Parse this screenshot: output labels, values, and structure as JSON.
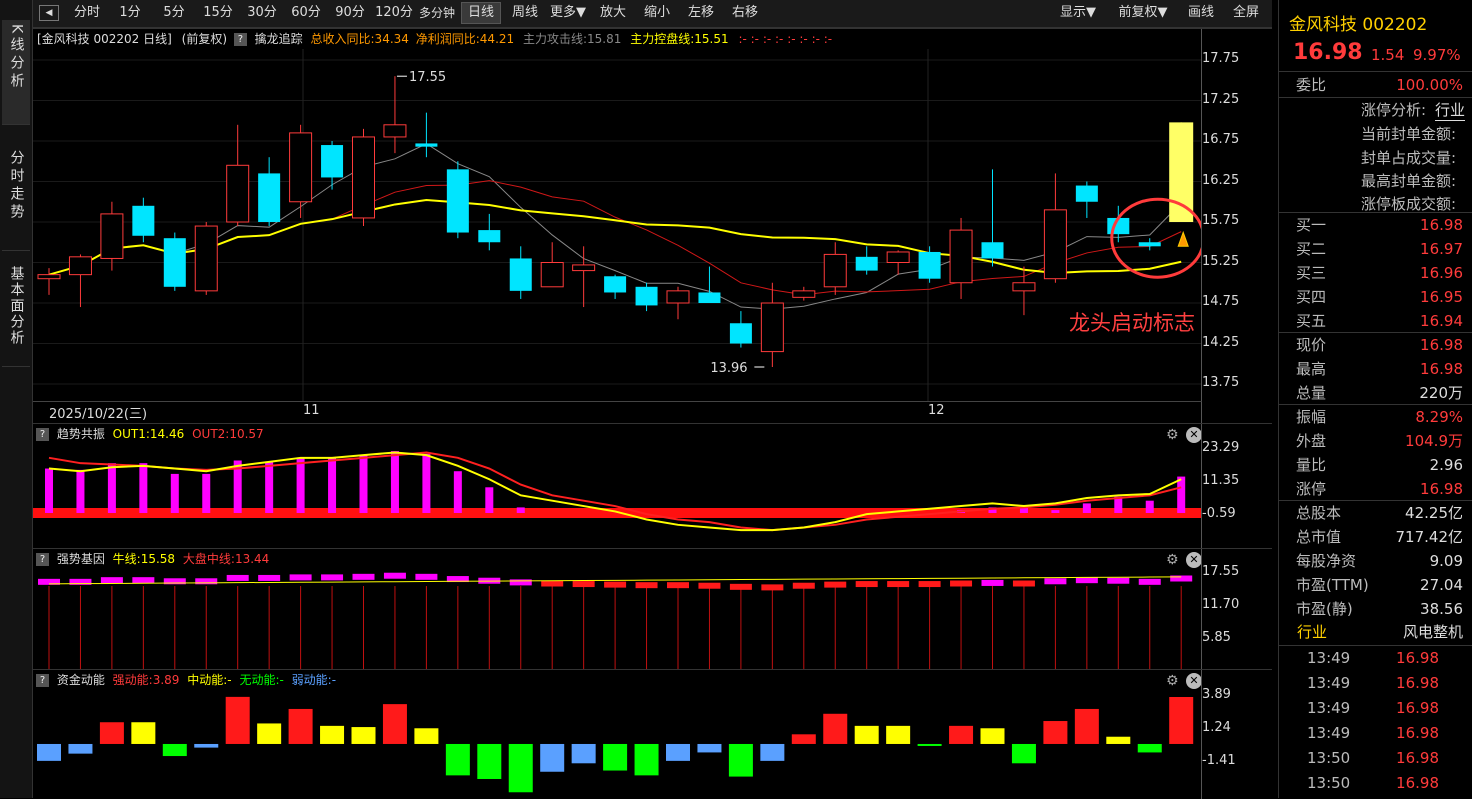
{
  "left_tabs": [
    "K线分析",
    "分时走势",
    "基本面分析"
  ],
  "toolbar": {
    "periods": [
      "分时",
      "1分",
      "5分",
      "15分",
      "30分",
      "60分",
      "90分",
      "120分",
      "多分钟",
      "日线",
      "周线",
      "更多▼",
      "放大",
      "缩小",
      "左移",
      "右移"
    ],
    "active": "日线",
    "right": [
      "显示▼",
      "前复权▼",
      "画线",
      "全屏"
    ]
  },
  "main": {
    "title": "[金风科技 002202 日线]",
    "fq": "(前复权)",
    "indicator": "擒龙追踪",
    "rev": "总收入同比:34.34",
    "profit": "净利润同比:44.21",
    "attack": "主力攻击线:15.81",
    "control": "主力控盘线:15.51",
    "dots": ":- :- :- :- :- :- :- :-",
    "y_ticks": [
      "17.75",
      "17.25",
      "16.75",
      "16.25",
      "15.75",
      "15.25",
      "14.75",
      "14.25",
      "13.75"
    ],
    "high_label": "17.55",
    "low_label": "13.96",
    "annotation": "龙头启动标志",
    "date_start": "2025/10/22(三)",
    "month1": "11",
    "month2": "12"
  },
  "candles": [
    [
      15.05,
      15.18,
      14.85,
      15.1
    ],
    [
      15.1,
      15.35,
      14.7,
      15.32
    ],
    [
      15.3,
      16.0,
      15.15,
      15.85
    ],
    [
      15.95,
      16.05,
      15.5,
      15.58
    ],
    [
      15.55,
      15.62,
      14.9,
      14.95
    ],
    [
      14.9,
      15.75,
      14.85,
      15.7
    ],
    [
      15.75,
      16.95,
      15.7,
      16.45
    ],
    [
      16.35,
      16.55,
      15.7,
      15.75
    ],
    [
      16.0,
      16.95,
      15.8,
      16.85
    ],
    [
      16.7,
      16.75,
      16.15,
      16.3
    ],
    [
      15.8,
      16.9,
      15.7,
      16.8
    ],
    [
      16.8,
      17.55,
      16.6,
      16.95
    ],
    [
      16.72,
      17.1,
      16.55,
      16.68
    ],
    [
      16.4,
      16.5,
      15.55,
      15.62
    ],
    [
      15.65,
      15.85,
      15.4,
      15.5
    ],
    [
      15.3,
      15.45,
      14.8,
      14.9
    ],
    [
      14.95,
      15.5,
      14.95,
      15.25
    ],
    [
      15.15,
      15.45,
      14.7,
      15.22
    ],
    [
      15.08,
      15.1,
      14.8,
      14.88
    ],
    [
      14.95,
      15.0,
      14.65,
      14.72
    ],
    [
      14.75,
      14.95,
      14.55,
      14.9
    ],
    [
      14.88,
      15.2,
      14.82,
      14.75
    ],
    [
      14.5,
      14.65,
      14.2,
      14.25
    ],
    [
      14.15,
      15.0,
      13.96,
      14.75
    ],
    [
      14.82,
      14.95,
      14.78,
      14.9
    ],
    [
      14.95,
      15.5,
      14.85,
      15.35
    ],
    [
      15.32,
      15.45,
      15.1,
      15.15
    ],
    [
      15.25,
      15.4,
      15.1,
      15.38
    ],
    [
      15.38,
      15.45,
      15.0,
      15.05
    ],
    [
      15.0,
      15.8,
      14.8,
      15.65
    ],
    [
      15.5,
      16.4,
      15.2,
      15.3
    ],
    [
      14.9,
      15.2,
      14.6,
      15.0
    ],
    [
      15.05,
      16.35,
      15.0,
      15.9
    ],
    [
      16.2,
      16.25,
      15.8,
      16.0
    ],
    [
      15.8,
      15.95,
      15.5,
      15.6
    ],
    [
      15.5,
      15.55,
      15.4,
      15.45
    ],
    [
      15.75,
      16.98,
      15.75,
      16.98
    ]
  ],
  "ind1": {
    "label": "趋势共振",
    "out1": "OUT1:14.46",
    "out2": "OUT2:10.57",
    "y_ticks": [
      "23.29",
      "11.35",
      "-0.59"
    ]
  },
  "ind2": {
    "label": "强势基因",
    "niu": "牛线:15.58",
    "dapan": "大盘中线:13.44",
    "y_ticks": [
      "17.55",
      "11.70",
      "5.85"
    ]
  },
  "ind3": {
    "label": "资金动能",
    "strong": "强动能:3.89",
    "mid": "中动能:-",
    "none": "无动能:-",
    "weak": "弱动能:-",
    "y_ticks": [
      "3.89",
      "1.24",
      "-1.41"
    ],
    "values": [
      -1.4,
      -0.8,
      1.8,
      1.8,
      -1.0,
      -0.3,
      3.9,
      1.7,
      2.9,
      1.5,
      1.4,
      3.3,
      1.3,
      -2.6,
      -2.9,
      -4.0,
      -2.3,
      -1.6,
      -2.2,
      -2.6,
      -1.4,
      -0.7,
      -2.7,
      -1.4,
      0.8,
      2.5,
      1.5,
      1.5,
      -0.1,
      1.5,
      1.3,
      -1.6,
      1.9,
      2.9,
      0.6,
      -0.7,
      3.89
    ],
    "colors": [
      "#5aa0ff",
      "#5aa0ff",
      "#ff1a1a",
      "#ffff00",
      "#00ff00",
      "#5aa0ff",
      "#ff1a1a",
      "#ffff00",
      "#ff1a1a",
      "#ffff00",
      "#ffff00",
      "#ff1a1a",
      "#ffff00",
      "#00ff00",
      "#00ff00",
      "#00ff00",
      "#5aa0ff",
      "#5aa0ff",
      "#00ff00",
      "#00ff00",
      "#5aa0ff",
      "#5aa0ff",
      "#00ff00",
      "#5aa0ff",
      "#ff1a1a",
      "#ff1a1a",
      "#ffff00",
      "#ffff00",
      "#00ff00",
      "#ff1a1a",
      "#ffff00",
      "#00ff00",
      "#ff1a1a",
      "#ff1a1a",
      "#ffff00",
      "#00ff00",
      "#ff1a1a"
    ]
  },
  "quote": {
    "name": "金风科技 002202",
    "price": "16.98",
    "change": "1.54",
    "pct": "9.97%",
    "webi_k": "委比",
    "webi_v": "100.00%",
    "zt_title": "涨停分析:",
    "zt_tag": "行业",
    "zt_items": [
      "当前封单金额:",
      "封单占成交量:",
      "最高封单金额:",
      "涨停板成交额:"
    ],
    "bids": [
      [
        "买一",
        "16.98"
      ],
      [
        "买二",
        "16.97"
      ],
      [
        "买三",
        "16.96"
      ],
      [
        "买四",
        "16.95"
      ],
      [
        "买五",
        "16.94"
      ]
    ],
    "stats1": [
      [
        "现价",
        "16.98"
      ],
      [
        "最高",
        "16.98"
      ],
      [
        "总量",
        "220万"
      ]
    ],
    "stats2": [
      [
        "振幅",
        "8.29%"
      ],
      [
        "外盘",
        "104.9万"
      ],
      [
        "量比",
        "2.96"
      ],
      [
        "涨停",
        "16.98"
      ]
    ],
    "stats3": [
      [
        "总股本",
        "42.25亿"
      ],
      [
        "总市值",
        "717.42亿"
      ],
      [
        "每股净资",
        "9.09"
      ],
      [
        "市盈(TTM)",
        "27.04"
      ],
      [
        "市盈(静)",
        "38.56"
      ]
    ],
    "industry_k": "行业",
    "industry_v": "风电整机",
    "ticks": [
      [
        "13:49",
        "16.98"
      ],
      [
        "13:49",
        "16.98"
      ],
      [
        "13:49",
        "16.98"
      ],
      [
        "13:49",
        "16.98"
      ],
      [
        "13:50",
        "16.98"
      ],
      [
        "13:50",
        "16.98"
      ]
    ]
  },
  "colors": {
    "up": "#ff3b3b",
    "down": "#00e5ff",
    "ma_yellow": "#ffff00",
    "magenta": "#ff00ff"
  }
}
